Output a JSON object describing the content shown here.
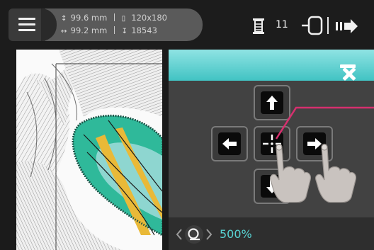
{
  "topbar": {
    "height_row": {
      "value": "99.6 mm"
    },
    "width_row": {
      "value": "99.2 mm"
    },
    "hoop_size": "120x180",
    "stitch_count": "18543",
    "color_count": "11"
  },
  "move_panel": {
    "zoom": "500%"
  },
  "colors": {
    "accent": "#4ac9c9",
    "panel_bg": "#424242",
    "callout_line": "#d62f6e",
    "design_teal": "#2fb99a",
    "design_yellow": "#e9b938"
  },
  "icons": {
    "menu": "menu-icon",
    "height": "height-arrow-icon",
    "width": "width-arrow-icon",
    "hoop": "hoop-icon",
    "stitch": "needle-icon",
    "spool": "spool-icon",
    "frame": "hoop-frame-icon",
    "next": "next-arrow-icon",
    "close": "close-icon",
    "up": "arrow-up-icon",
    "down": "arrow-down-icon",
    "left": "arrow-left-icon",
    "right": "arrow-right-icon",
    "center": "crosshair-icon",
    "zoom": "zoom-lens-icon"
  }
}
